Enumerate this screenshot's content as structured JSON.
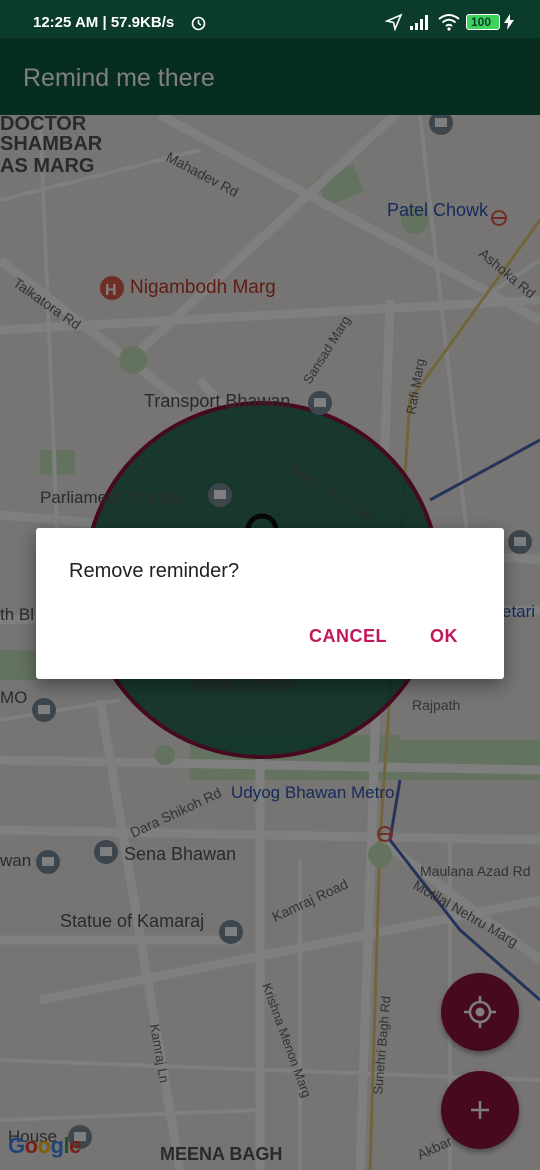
{
  "status_bar": {
    "time": "12:25 AM | 57.9KB/s",
    "battery": "100"
  },
  "app_bar": {
    "title": "Remind me there"
  },
  "map": {
    "labels": [
      {
        "text": "DOCTOR",
        "bold": true
      },
      {
        "text": "SHAMBAR",
        "bold": true
      },
      {
        "text": "AS MARG",
        "bold": true
      },
      {
        "text": "Mahadev Rd"
      },
      {
        "text": "Patel Chowk"
      },
      {
        "text": "Ashoka Rd"
      },
      {
        "text": "Talkatora Rd"
      },
      {
        "text": "Nigambodh Marg"
      },
      {
        "text": "Sansad Marg"
      },
      {
        "text": "Rafi Marg"
      },
      {
        "text": "Transport Bhawan"
      },
      {
        "text": "Parliament Of India"
      },
      {
        "text": "Red Cross Road"
      },
      {
        "text": "th Bl"
      },
      {
        "text": "etari"
      },
      {
        "text": "New Delhi"
      },
      {
        "text": "MO"
      },
      {
        "text": "Rajpath"
      },
      {
        "text": "Dara Shikoh Rd"
      },
      {
        "text": "Udyog Bhawan Metro"
      },
      {
        "text": "wan"
      },
      {
        "text": "Sena Bhawan"
      },
      {
        "text": "Maulana Azad Rd"
      },
      {
        "text": "Kamraj Road"
      },
      {
        "text": "Motilal Nehru Marg"
      },
      {
        "text": "Statue of Kamaraj"
      },
      {
        "text": "Krishna Menon Marg"
      },
      {
        "text": "Sunehri Bagh Rd"
      },
      {
        "text": "Kamraj Ln"
      },
      {
        "text": "House"
      },
      {
        "text": "MEENA BAGH",
        "bold": true
      },
      {
        "text": "Akbar"
      }
    ],
    "google_logo": [
      "G",
      "o",
      "o",
      "g",
      "l",
      "e"
    ],
    "google_colors": [
      "#4285F4",
      "#EA4335",
      "#FBBC05",
      "#4285F4",
      "#34A853",
      "#EA4335"
    ],
    "geofence_color": "#8e1340",
    "geofence_fill": "#0f5b44"
  },
  "dialog": {
    "message": "Remove reminder?",
    "cancel_label": "CANCEL",
    "ok_label": "OK"
  },
  "fabs": {
    "my_location_icon": "crosshair-icon",
    "add_icon": "plus-icon"
  }
}
